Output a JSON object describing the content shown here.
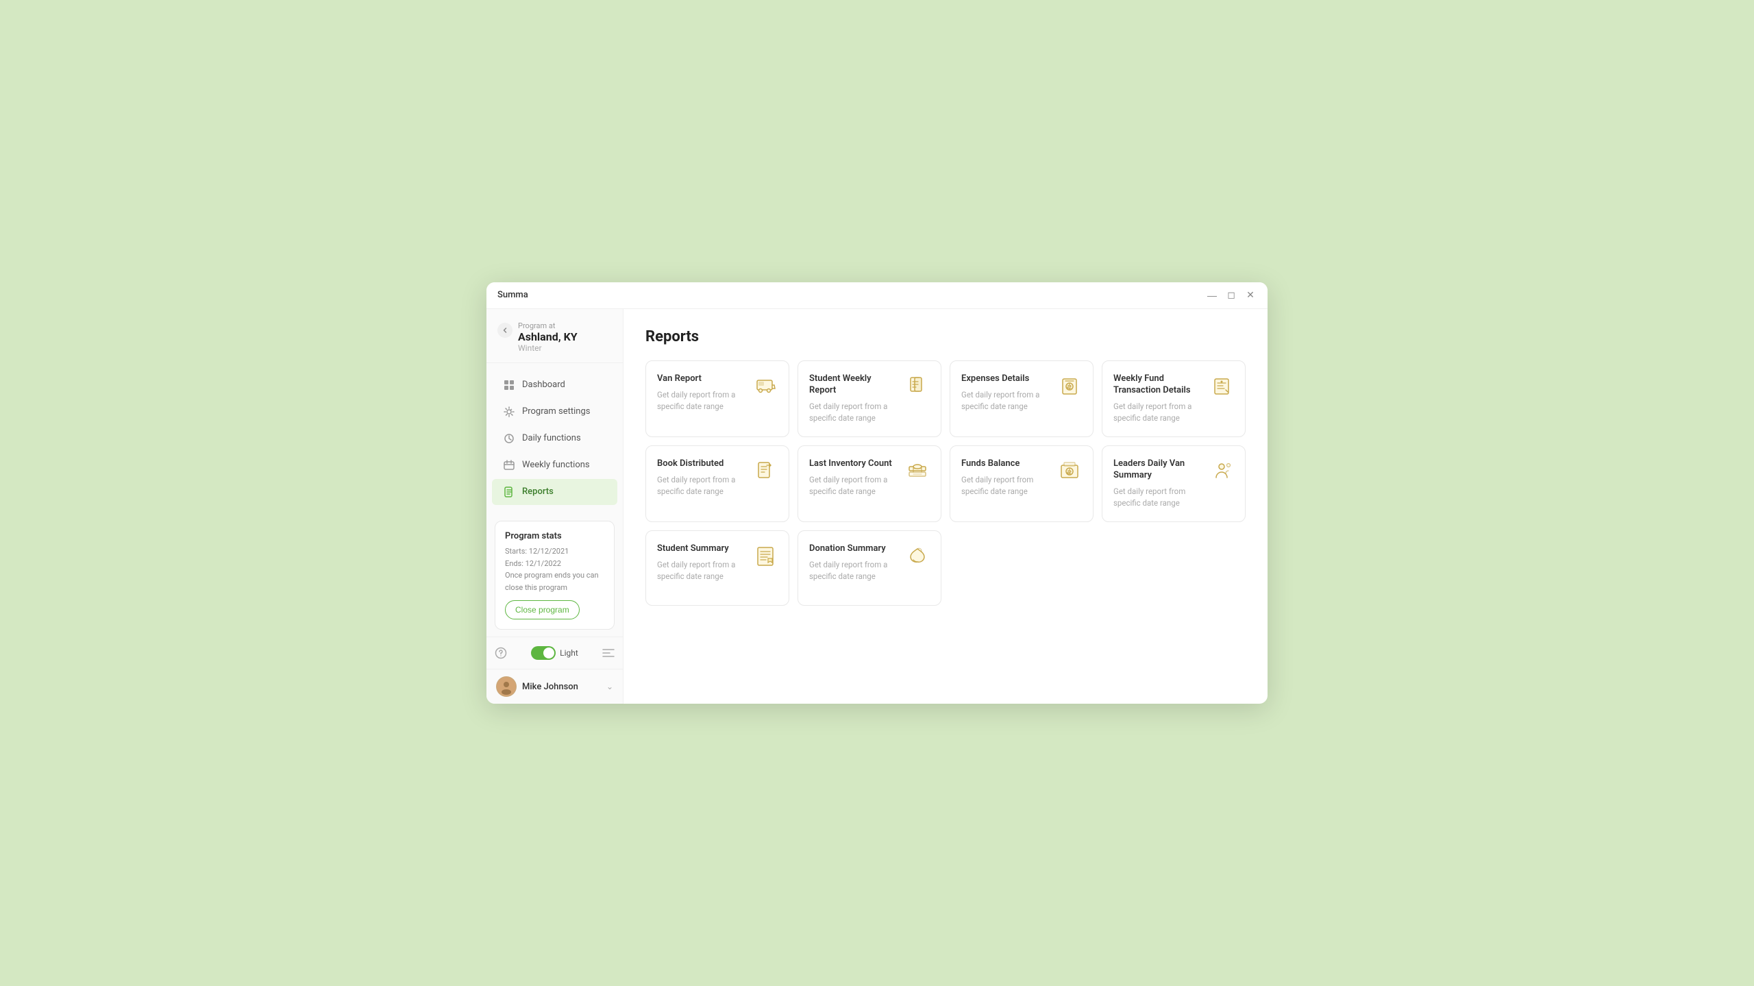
{
  "window": {
    "title": "Summa"
  },
  "sidebar": {
    "back_label": "←",
    "program_label": "Program at",
    "program_name": "Ashland, KY",
    "program_sub": "Winter",
    "nav_items": [
      {
        "id": "dashboard",
        "label": "Dashboard",
        "active": false
      },
      {
        "id": "program-settings",
        "label": "Program settings",
        "active": false
      },
      {
        "id": "daily-functions",
        "label": "Daily functions",
        "active": false
      },
      {
        "id": "weekly-functions",
        "label": "Weekly functions",
        "active": false
      },
      {
        "id": "reports",
        "label": "Reports",
        "active": true
      }
    ],
    "stats": {
      "title": "Program stats",
      "starts": "Starts: 12/12/2021",
      "ends": "Ends: 12/1/2022",
      "note": "Once program ends you can close this program",
      "close_btn": "Close program"
    },
    "theme_label": "Light",
    "user_name": "Mike Johnson"
  },
  "main": {
    "page_title": "Reports",
    "reports": [
      {
        "id": "van-report",
        "title": "Van Report",
        "desc": "Get daily report from a specific date range",
        "icon": "van"
      },
      {
        "id": "student-weekly-report",
        "title": "Student Weekly Report",
        "desc": "Get daily report from a specific date range",
        "icon": "student-weekly"
      },
      {
        "id": "expenses-details",
        "title": "Expenses Details",
        "desc": "Get daily report from a specific date range",
        "icon": "expenses"
      },
      {
        "id": "weekly-fund-transaction",
        "title": "Weekly Fund Transaction Details",
        "desc": "Get daily report from a specific date range",
        "icon": "weekly-fund"
      },
      {
        "id": "book-distributed",
        "title": "Book Distributed",
        "desc": "Get daily report from a specific date range",
        "icon": "book"
      },
      {
        "id": "last-inventory-count",
        "title": "Last Inventory Count",
        "desc": "Get daily report from a specific date range",
        "icon": "inventory"
      },
      {
        "id": "funds-balance",
        "title": "Funds Balance",
        "desc": "Get daily report from specific date range",
        "icon": "funds"
      },
      {
        "id": "leaders-daily-van",
        "title": "Leaders Daily Van Summary",
        "desc": "Get daily report from specific date range",
        "icon": "leaders-van"
      },
      {
        "id": "student-summary",
        "title": "Student Summary",
        "desc": "Get daily report from a specific date range",
        "icon": "student-summary"
      },
      {
        "id": "donation-summary",
        "title": "Donation Summary",
        "desc": "Get daily report from a specific date range",
        "icon": "donation"
      }
    ]
  }
}
